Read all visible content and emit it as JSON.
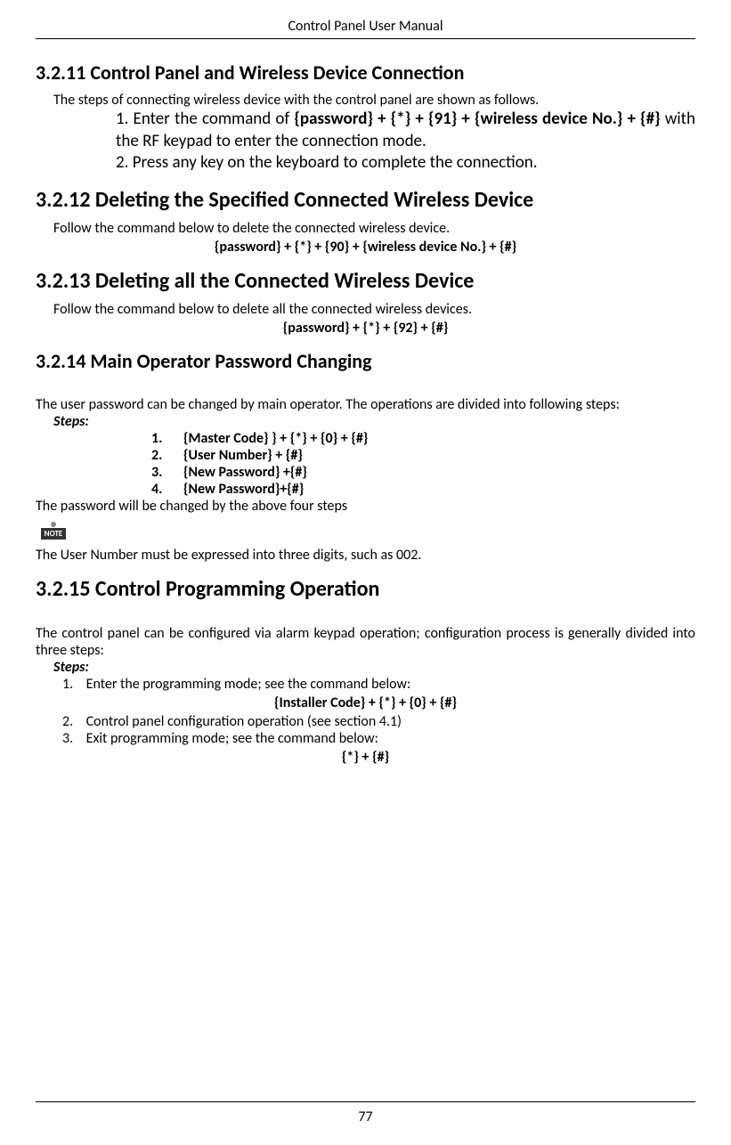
{
  "header": {
    "title": "Control Panel User Manual"
  },
  "s3211": {
    "heading": "3.2.11  Control Panel and Wireless Device Connection",
    "intro": "The steps of connecting wireless device with the control panel are shown as follows.",
    "item1_pre": "1. Enter the command of ",
    "item1_cmd": "{password} + {*} + {91} + {wireless device No.} + {#}",
    "item1_post": " with the RF keypad to enter the connection mode.",
    "item2": "2. Press any key on the keyboard to complete the connection."
  },
  "s3212": {
    "heading": "3.2.12  Deleting the Specified Connected Wireless Device",
    "intro": "Follow the command below to delete the connected wireless device.",
    "cmd": "{password} + {*} + {90} + {wireless device No.} + {#}"
  },
  "s3213": {
    "heading": "3.2.13  Deleting all the Connected Wireless Device",
    "intro": "Follow the command below to delete all the connected wireless devices.",
    "cmd": "{password} + {*} + {92} + {#}"
  },
  "s3214": {
    "heading": "3.2.14 Main Operator Password Changing",
    "intro": "The user password can be changed by main operator. The operations are divided into following steps:",
    "steps_label": "Steps:",
    "steps": {
      "n1": "1.",
      "s1": "{Master Code} } + {*} + {0} + {#}",
      "n2": "2.",
      "s2": "{User Number} + {#}",
      "n3": "3.",
      "s3": "{New Password} +{#}",
      "n4": "4.",
      "s4": "{New Password}+{#}"
    },
    "after_steps": "The password will be changed by the above four steps",
    "note_label": "NOTE",
    "note_text": "The User Number must be expressed into three digits, such as 002."
  },
  "s3215": {
    "heading": "3.2.15 Control Programming Operation",
    "intro": "The control panel can be configured via alarm keypad operation; configuration process is generally divided into three steps:",
    "steps_label": "Steps:",
    "steps": {
      "n1": "1.",
      "s1": "Enter the programming mode; see the command below:",
      "s1_cmd": "{Installer Code} + {*} + {0} + {#}",
      "n2": "2.",
      "s2": "Control panel    configuration operation (see section 4.1)",
      "n3": "3.",
      "s3": "Exit programming mode; see the command below:",
      "s3_cmd": "{*} + {#}"
    }
  },
  "footer": {
    "page": "77"
  }
}
